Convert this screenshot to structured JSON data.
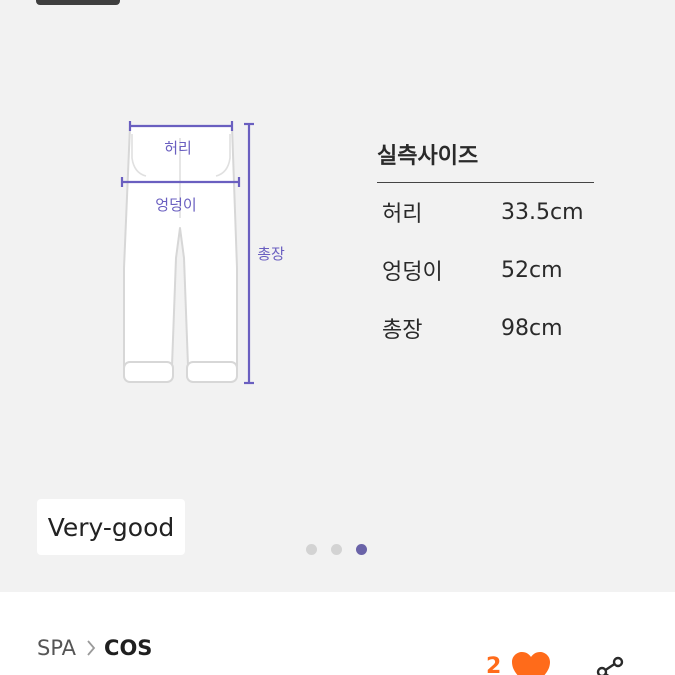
{
  "gallery": {
    "diagram_labels": {
      "waist": "허리",
      "hip": "엉덩이",
      "length": "총장"
    },
    "size_table": {
      "title": "실측사이즈",
      "rows": [
        {
          "label": "허리",
          "value": "33.5cm"
        },
        {
          "label": "엉덩이",
          "value": "52cm"
        },
        {
          "label": "총장",
          "value": "98cm"
        }
      ]
    },
    "condition_badge": "Very-good",
    "pagination": {
      "total": 3,
      "current": 3
    }
  },
  "breadcrumb": {
    "parent": "SPA",
    "current": "COS"
  },
  "likes": {
    "count": "2"
  },
  "colors": {
    "accent": "#ff6b1a",
    "measure_line": "#6a5fc0",
    "active_dot": "#6a63a8"
  },
  "icons": [
    "chevron-right-icon",
    "heart-icon",
    "share-icon"
  ]
}
